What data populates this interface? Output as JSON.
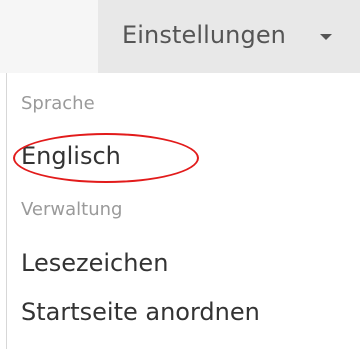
{
  "navbar": {
    "settings_label": "Einstellungen"
  },
  "menu": {
    "language_header": "Sprache",
    "english_item": "Englisch",
    "admin_header": "Verwaltung",
    "bookmarks_item": "Lesezeichen",
    "arrange_homepage_item": "Startseite anordnen"
  },
  "colors": {
    "highlight": "#e21b1b",
    "header_text": "#9a9a9a",
    "item_text": "#333333",
    "toggle_bg": "#e8e8e8"
  }
}
